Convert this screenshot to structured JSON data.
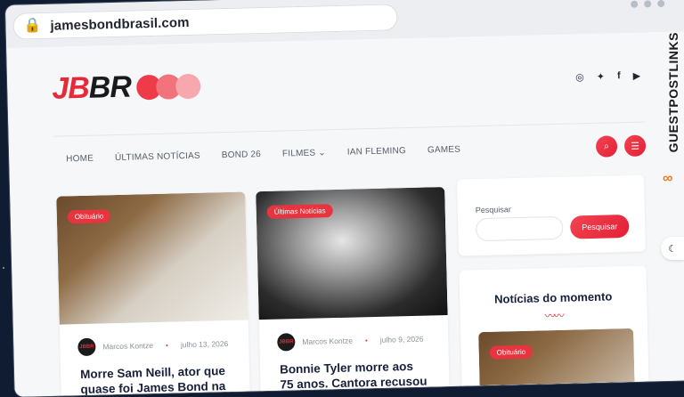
{
  "browser": {
    "url": "jamesbondbrasil.com"
  },
  "site": {
    "logo_text_red": "JB",
    "logo_text_dark": "BR",
    "social": [
      "instagram-icon",
      "twitter-icon",
      "facebook-icon",
      "youtube-icon"
    ],
    "social_glyphs": {
      "instagram": "◎",
      "twitter": "✦",
      "facebook": "f",
      "youtube": "▶"
    }
  },
  "nav": {
    "items": [
      {
        "label": "HOME"
      },
      {
        "label": "ÚLTIMAS NOTÍCIAS"
      },
      {
        "label": "BOND 26"
      },
      {
        "label": "FILMES ⌄"
      },
      {
        "label": "IAN FLEMING"
      },
      {
        "label": "GAMES"
      }
    ]
  },
  "posts": [
    {
      "tag": "Obituário",
      "author": "Marcos Kontze",
      "date": "julho 13, 2026",
      "title": "Morre Sam Neill, ator que quase foi James Bond na"
    },
    {
      "tag": "Últimas Notícias",
      "author": "Marcos Kontze",
      "date": "julho 9, 2026",
      "title": "Bonnie Tyler morre aos 75 anos. Cantora recusou"
    }
  ],
  "avatar_text": "JBBR",
  "sidebar": {
    "search_label": "Pesquisar",
    "search_button": "Pesquisar",
    "trending_title": "Notícias do momento",
    "trending_tag": "Obituário"
  },
  "brand_side": {
    "text": "GUESTPOSTLINKS"
  },
  "colors": {
    "accent": "#e8343f",
    "dark": "#17203a"
  }
}
